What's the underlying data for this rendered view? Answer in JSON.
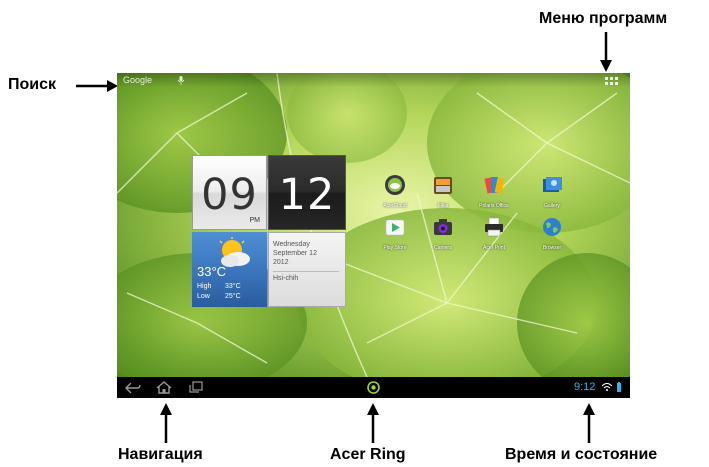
{
  "annotations": {
    "search": "Поиск",
    "apps_menu": "Меню программ",
    "navigation": "Навигация",
    "acer_ring": "Acer Ring",
    "time_status": "Время и состояние"
  },
  "status_bar": {
    "search_label": "Google"
  },
  "clock_widget": {
    "hours": "09",
    "minutes": "12",
    "ampm": "PM"
  },
  "weather_widget": {
    "temperature": "33°C",
    "high_label": "High",
    "high_value": "33°C",
    "low_label": "Low",
    "low_value": "25°C",
    "icon": "sun-cloud-icon"
  },
  "calendar_widget": {
    "weekday": "Wednesday",
    "date": "September 12",
    "year": "2012",
    "location": "Hsi-chih"
  },
  "apps": [
    {
      "label": "AcerCloud",
      "icon": "acercloud-icon"
    },
    {
      "label": "Files",
      "icon": "files-icon"
    },
    {
      "label": "Polaris Office",
      "icon": "office-icon"
    },
    {
      "label": "Gallery",
      "icon": "gallery-icon"
    },
    {
      "label": "Play Store",
      "icon": "play-store-icon"
    },
    {
      "label": "Camera",
      "icon": "camera-icon"
    },
    {
      "label": "Acer Print",
      "icon": "printer-icon"
    },
    {
      "label": "Browser",
      "icon": "globe-icon"
    }
  ],
  "navbar": {
    "time": "9:12",
    "icons": [
      "back-icon",
      "home-icon",
      "recent-apps-icon",
      "acer-ring-icon",
      "wifi-icon",
      "battery-icon"
    ]
  },
  "colors": {
    "nav_accent": "#33b5e5",
    "navbar_bg": "#000000"
  }
}
